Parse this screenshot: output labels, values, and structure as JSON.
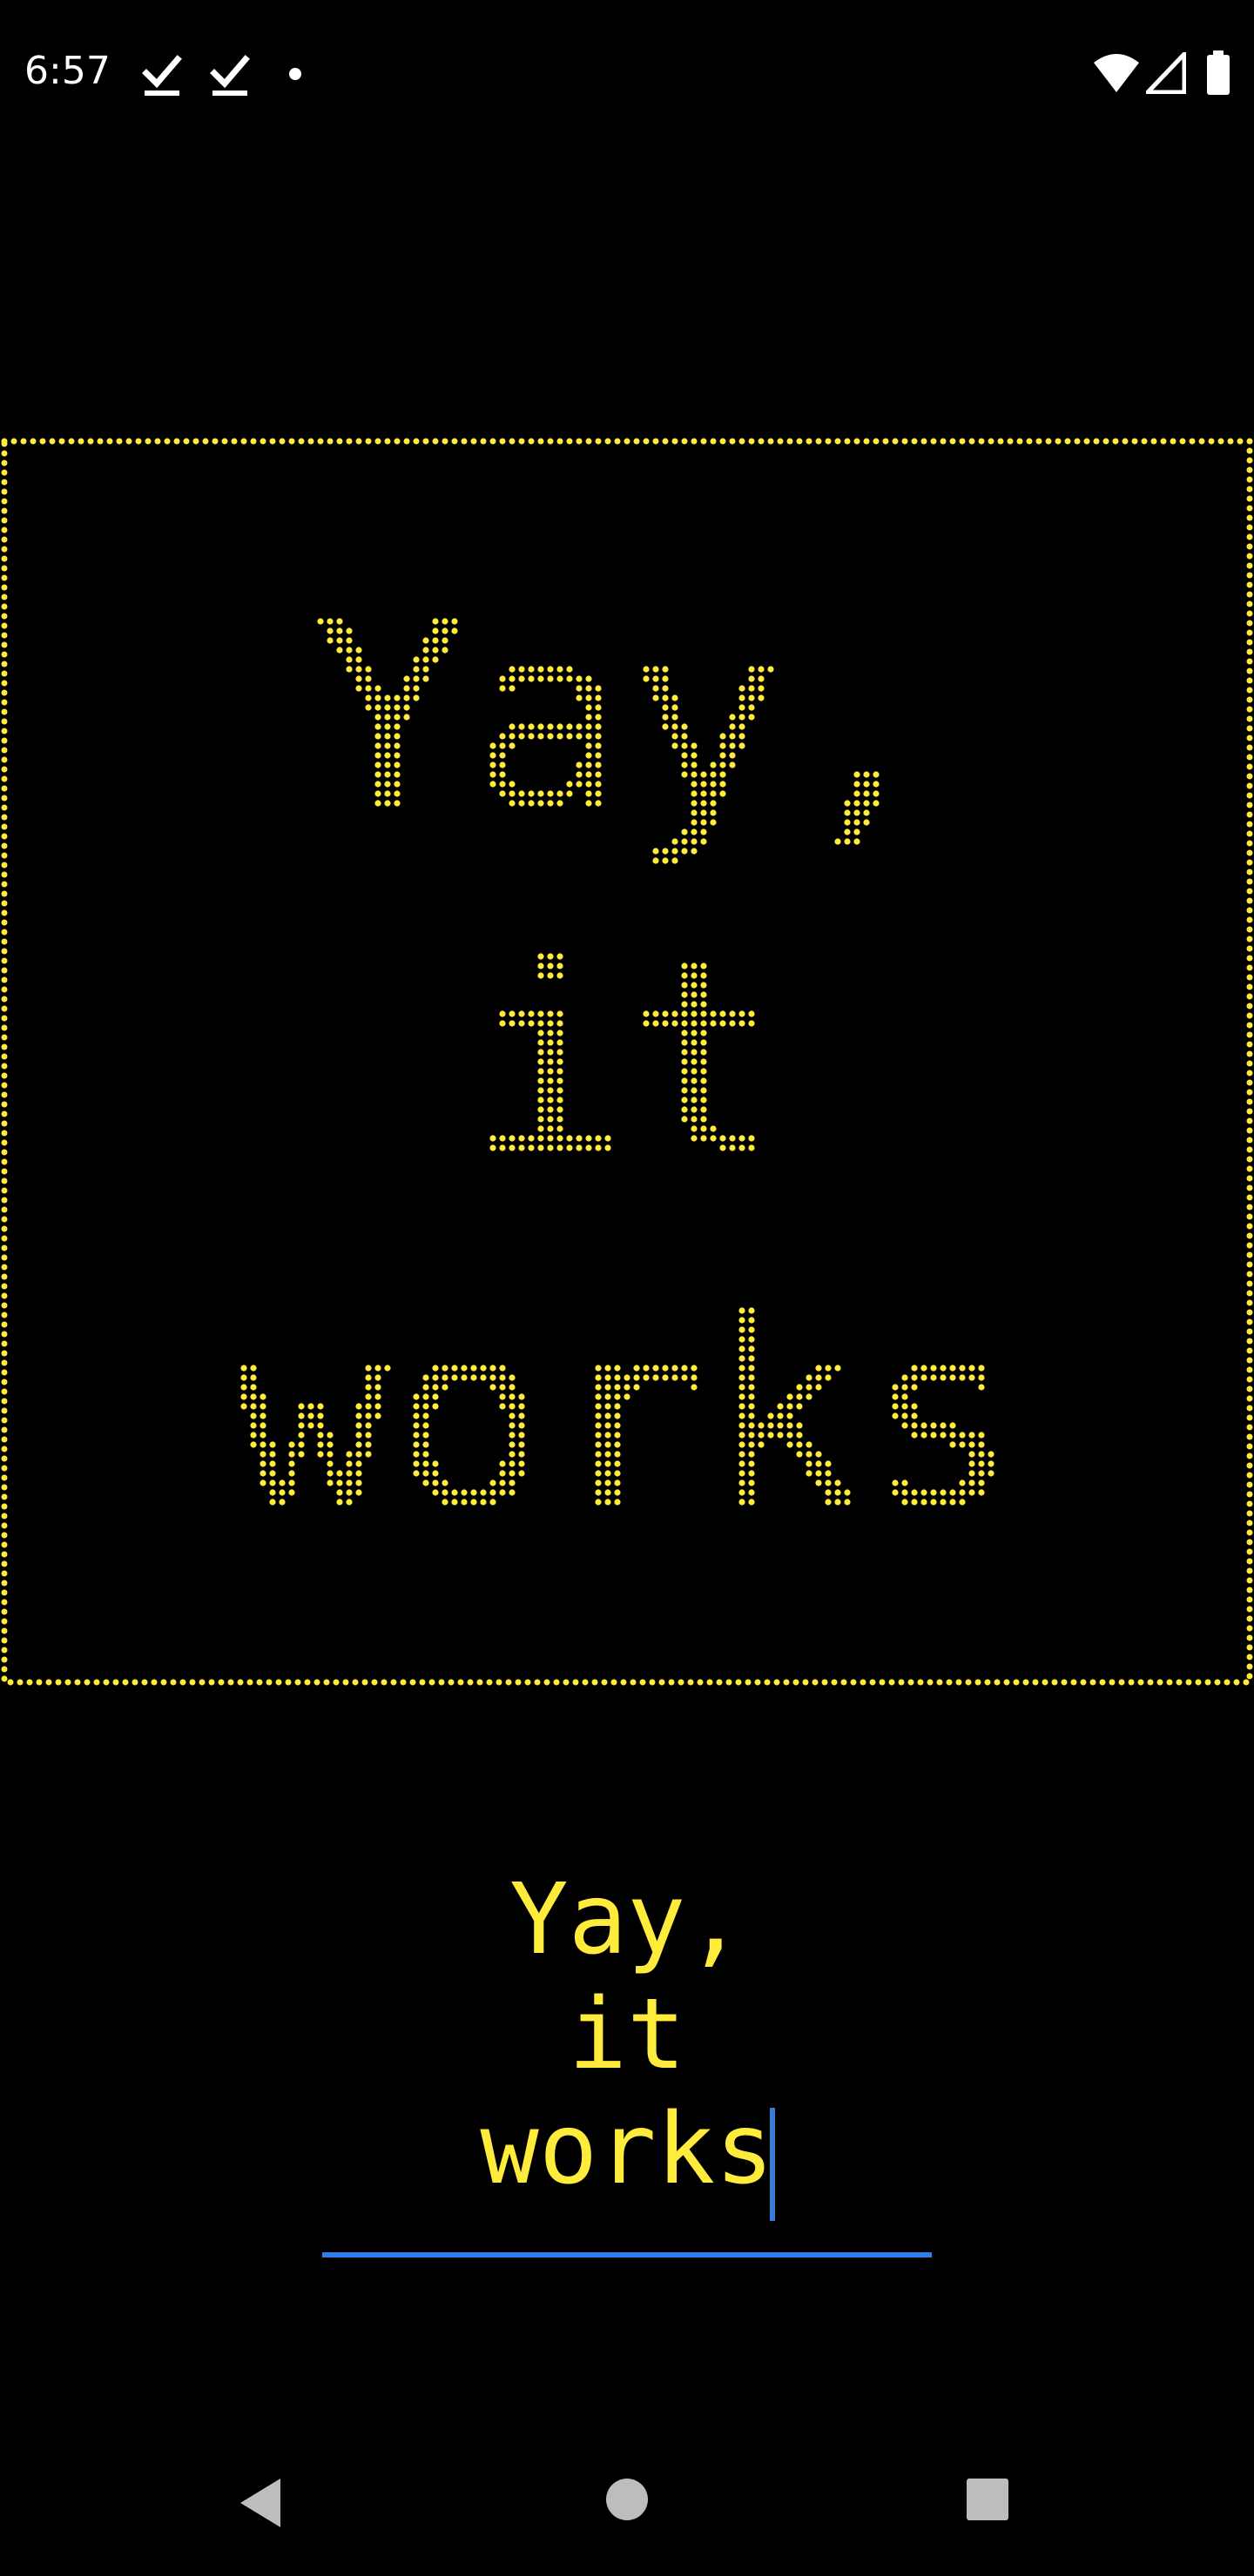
{
  "status_bar": {
    "time": "6:57",
    "icons": [
      "download-done-icon",
      "download-done-icon",
      "notification-dot-icon",
      "wifi-icon",
      "cell-signal-icon",
      "battery-icon"
    ]
  },
  "led_display": {
    "lines": [
      "Yay,",
      "it",
      "works"
    ],
    "dot_color": "#ffeb3b",
    "border_style": "dotted"
  },
  "text_field": {
    "lines": [
      "Yay,",
      "it",
      "works"
    ],
    "text_color": "#ffeb3b",
    "accent_color": "#2f80ed"
  },
  "nav_bar": {
    "buttons": [
      "back-icon",
      "home-icon",
      "recents-icon"
    ],
    "color": "#bdbdbd"
  },
  "colors": {
    "background": "#000000",
    "status_text": "#ffffff"
  }
}
